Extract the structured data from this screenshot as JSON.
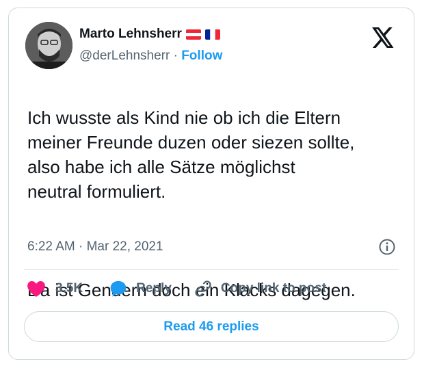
{
  "author": {
    "name": "Marto Lehnsherr",
    "handle": "@derLehnsherr",
    "separator": "·",
    "follow_label": "Follow"
  },
  "tweet": {
    "paragraph_1": "Ich wusste als Kind nie ob ich die Eltern\nmeiner Freunde duzen oder siezen sollte,\nalso habe ich alle Sätze möglichst\nneutral formuliert.",
    "paragraph_2": "Da ist Gendern doch ein Klacks dagegen.",
    "timestamp": "6:22 AM · Mar 22, 2021"
  },
  "actions": {
    "like_count": "3.5K",
    "reply_label": "Reply",
    "copy_link_label": "Copy link to post"
  },
  "read_replies_label": "Read 46 replies",
  "colors": {
    "accent": "#1d9bf0",
    "like": "#f91880",
    "text": "#0f1419",
    "secondary": "#536471",
    "border": "#cfd9de"
  },
  "icons": [
    "x-logo-icon",
    "info-icon",
    "heart-icon",
    "reply-bubble-icon",
    "link-icon",
    "austria-flag-icon",
    "france-flag-icon"
  ]
}
